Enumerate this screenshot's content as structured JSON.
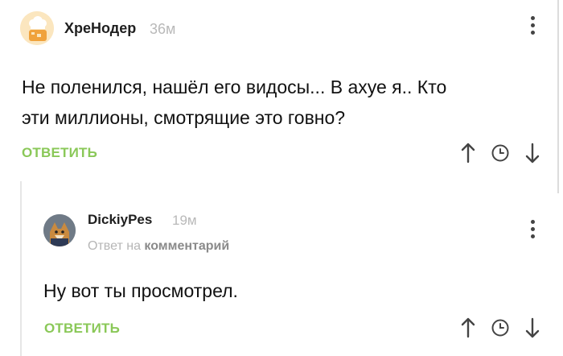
{
  "comment1": {
    "username": "ХреНодер",
    "time": "36м",
    "text_line1": "Не поленился, нашёл его видосы... В ахуе я.. Кто",
    "text_line2": "эти миллионы, смотрящие это говно?",
    "reply_label": "ОТВЕТИТЬ"
  },
  "comment2": {
    "username": "DickiyPes",
    "time": "19м",
    "reply_to_prefix": "Ответ на",
    "reply_to_target": "комментарий",
    "text": "Ну вот ты просмотрел.",
    "reply_label": "ОТВЕТИТЬ"
  },
  "icons": {
    "upvote": "arrow-up-icon",
    "timer": "clock-icon",
    "downvote": "arrow-down-icon",
    "menu": "kebab-menu-icon"
  },
  "colors": {
    "accent": "#8ac858",
    "muted": "#b9b9b9"
  }
}
